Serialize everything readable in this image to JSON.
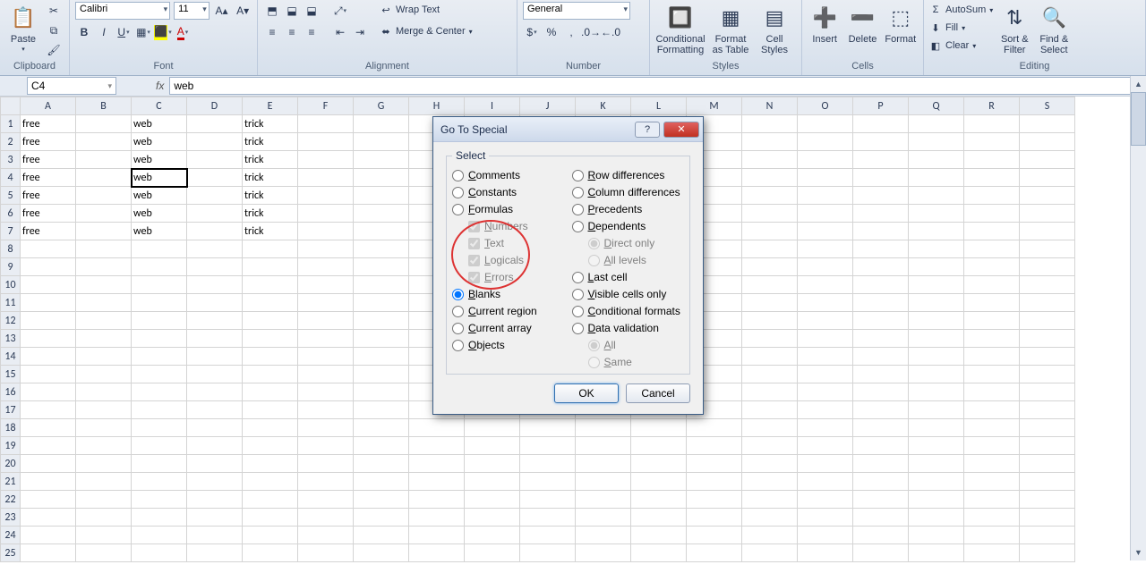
{
  "ribbon": {
    "clipboard": {
      "label": "Clipboard",
      "paste": "Paste"
    },
    "font": {
      "label": "Font",
      "family": "Calibri",
      "size": "11"
    },
    "alignment": {
      "label": "Alignment",
      "wrap": "Wrap Text",
      "merge": "Merge & Center"
    },
    "number": {
      "label": "Number",
      "format": "General"
    },
    "styles": {
      "label": "Styles",
      "cond": "Conditional\nFormatting",
      "table": "Format\nas Table",
      "cell": "Cell\nStyles"
    },
    "cells": {
      "label": "Cells",
      "insert": "Insert",
      "delete": "Delete",
      "format": "Format"
    },
    "editing": {
      "label": "Editing",
      "autosum": "AutoSum",
      "fill": "Fill",
      "clear": "Clear",
      "sort": "Sort &\nFilter",
      "find": "Find &\nSelect"
    }
  },
  "formula_bar": {
    "name_box": "C4",
    "fx": "fx",
    "formula": "web"
  },
  "columns": [
    "A",
    "B",
    "C",
    "D",
    "E",
    "F",
    "G",
    "H",
    "I",
    "J",
    "K",
    "L",
    "M",
    "N",
    "O",
    "P",
    "Q",
    "R",
    "S"
  ],
  "row_count": 25,
  "active": {
    "row": 4,
    "col": "C"
  },
  "sheet_data": {
    "A": [
      "free",
      "free",
      "free",
      "free",
      "free",
      "free",
      "free"
    ],
    "C": [
      "web",
      "web",
      "web",
      "web",
      "web",
      "web",
      "web"
    ],
    "E": [
      "trick",
      "trick",
      "trick",
      "trick",
      "trick",
      "trick",
      "trick"
    ]
  },
  "dialog": {
    "title": "Go To Special",
    "legend": "Select",
    "left": [
      {
        "key": "comments",
        "label": "Comments",
        "type": "radio",
        "checked": false
      },
      {
        "key": "constants",
        "label": "Constants",
        "type": "radio",
        "checked": false
      },
      {
        "key": "formulas",
        "label": "Formulas",
        "type": "radio",
        "checked": false
      },
      {
        "key": "numbers",
        "label": "Numbers",
        "type": "check",
        "checked": true,
        "disabled": true,
        "sub": true
      },
      {
        "key": "text",
        "label": "Text",
        "type": "check",
        "checked": true,
        "disabled": true,
        "sub": true
      },
      {
        "key": "logicals",
        "label": "Logicals",
        "type": "check",
        "checked": true,
        "disabled": true,
        "sub": true
      },
      {
        "key": "errors",
        "label": "Errors",
        "type": "check",
        "checked": true,
        "disabled": true,
        "sub": true
      },
      {
        "key": "blanks",
        "label": "Blanks",
        "type": "radio",
        "checked": true
      },
      {
        "key": "region",
        "label": "Current region",
        "type": "radio",
        "checked": false
      },
      {
        "key": "array",
        "label": "Current array",
        "type": "radio",
        "checked": false
      },
      {
        "key": "objects",
        "label": "Objects",
        "type": "radio",
        "checked": false
      }
    ],
    "right": [
      {
        "key": "rowdiff",
        "label": "Row differences",
        "type": "radio",
        "checked": false
      },
      {
        "key": "coldiff",
        "label": "Column differences",
        "type": "radio",
        "checked": false
      },
      {
        "key": "preced",
        "label": "Precedents",
        "type": "radio",
        "checked": false
      },
      {
        "key": "depend",
        "label": "Dependents",
        "type": "radio",
        "checked": false
      },
      {
        "key": "direct",
        "label": "Direct only",
        "type": "radio",
        "checked": true,
        "disabled": true,
        "sub": true
      },
      {
        "key": "alllev",
        "label": "All levels",
        "type": "radio",
        "checked": false,
        "disabled": true,
        "sub": true
      },
      {
        "key": "last",
        "label": "Last cell",
        "type": "radio",
        "checked": false
      },
      {
        "key": "visible",
        "label": "Visible cells only",
        "type": "radio",
        "checked": false
      },
      {
        "key": "condfmt",
        "label": "Conditional formats",
        "type": "radio",
        "checked": false
      },
      {
        "key": "datavalid",
        "label": "Data validation",
        "type": "radio",
        "checked": false
      },
      {
        "key": "all",
        "label": "All",
        "type": "radio",
        "checked": true,
        "disabled": true,
        "sub": true
      },
      {
        "key": "same",
        "label": "Same",
        "type": "radio",
        "checked": false,
        "disabled": true,
        "sub": true
      }
    ],
    "ok": "OK",
    "cancel": "Cancel"
  }
}
